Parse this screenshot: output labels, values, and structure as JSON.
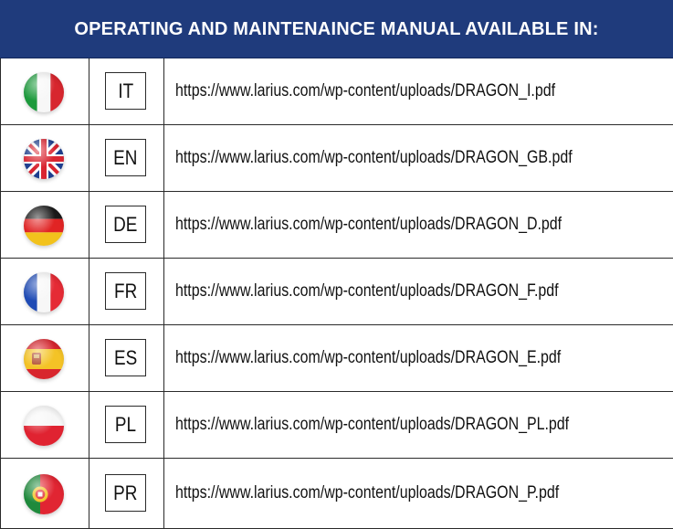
{
  "header": {
    "title": "OPERATING AND MAINTENAINCE MANUAL AVAILABLE IN:"
  },
  "rows": [
    {
      "flag_icon": "italy-flag-icon",
      "code": "IT",
      "url": "https://www.larius.com/wp-content/uploads/DRAGON_I.pdf"
    },
    {
      "flag_icon": "uk-flag-icon",
      "code": "EN",
      "url": "https://www.larius.com/wp-content/uploads/DRAGON_GB.pdf"
    },
    {
      "flag_icon": "germany-flag-icon",
      "code": "DE",
      "url": "https://www.larius.com/wp-content/uploads/DRAGON_D.pdf"
    },
    {
      "flag_icon": "france-flag-icon",
      "code": "FR",
      "url": "https://www.larius.com/wp-content/uploads/DRAGON_F.pdf"
    },
    {
      "flag_icon": "spain-flag-icon",
      "code": "ES",
      "url": "https://www.larius.com/wp-content/uploads/DRAGON_E.pdf"
    },
    {
      "flag_icon": "poland-flag-icon",
      "code": "PL",
      "url": "https://www.larius.com/wp-content/uploads/DRAGON_PL.pdf"
    },
    {
      "flag_icon": "portugal-flag-icon",
      "code": "PR",
      "url": "https://www.larius.com/wp-content/uploads/DRAGON_P.pdf"
    }
  ],
  "colors": {
    "header_background": "#1f3b7c",
    "header_text": "#ffffff",
    "border": "#2a2a2a"
  }
}
